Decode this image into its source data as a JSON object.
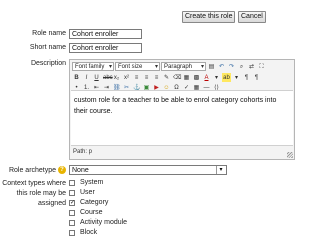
{
  "buttons": {
    "create": "Create this role",
    "cancel": "Cancel"
  },
  "form": {
    "role_name": {
      "label": "Role name",
      "value": "Cohort enroller"
    },
    "short_name": {
      "label": "Short name",
      "value": "Cohort enroller"
    },
    "description": {
      "label": "Description",
      "toolbar1": {
        "font_family": "Font family",
        "font_size": "Font size",
        "format": "Paragraph"
      },
      "content": "custom role for a teacher to be able to enrol category cohorts into their course.",
      "path": "Path: p"
    },
    "archetype": {
      "label": "Role archetype",
      "value": "None"
    },
    "context_types": {
      "label_lines": [
        "Context types where",
        "this role may be",
        "assigned"
      ],
      "options": [
        {
          "label": "System",
          "checked": false
        },
        {
          "label": "User",
          "checked": false
        },
        {
          "label": "Category",
          "checked": true
        },
        {
          "label": "Course",
          "checked": false
        },
        {
          "label": "Activity module",
          "checked": false
        },
        {
          "label": "Block",
          "checked": false
        }
      ]
    }
  }
}
